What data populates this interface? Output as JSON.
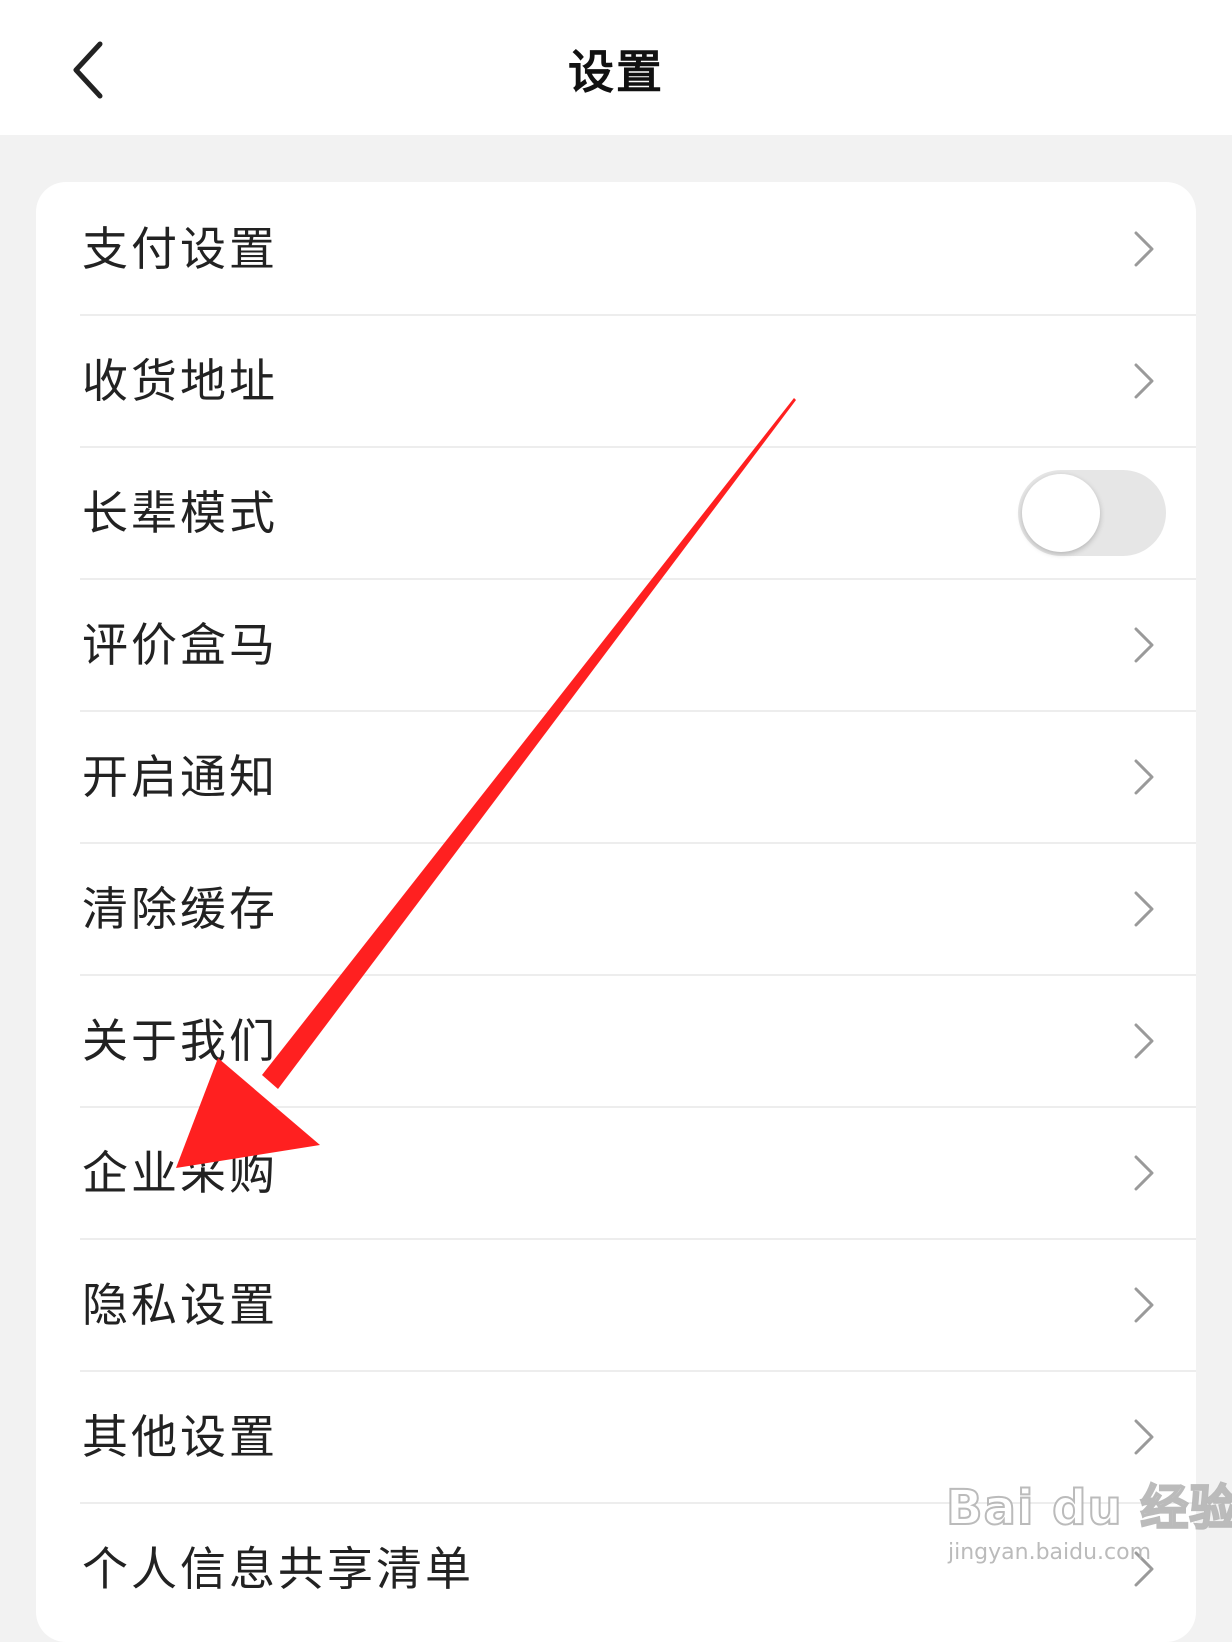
{
  "header": {
    "title": "设置",
    "back_icon": "chevron-left-icon"
  },
  "settings": {
    "items": [
      {
        "label": "支付设置",
        "control": "chevron"
      },
      {
        "label": "收货地址",
        "control": "chevron"
      },
      {
        "label": "长辈模式",
        "control": "toggle",
        "enabled": false
      },
      {
        "label": "评价盒马",
        "control": "chevron"
      },
      {
        "label": "开启通知",
        "control": "chevron"
      },
      {
        "label": "清除缓存",
        "control": "chevron"
      },
      {
        "label": "关于我们",
        "control": "chevron"
      },
      {
        "label": "企业采购",
        "control": "chevron"
      },
      {
        "label": "隐私设置",
        "control": "chevron"
      },
      {
        "label": "其他设置",
        "control": "chevron"
      },
      {
        "label": "个人信息共享清单",
        "control": "chevron"
      }
    ]
  },
  "annotation": {
    "type": "arrow",
    "color": "#ff2020",
    "points_to": "企业采购"
  },
  "watermark": {
    "logo": "Bai du 经验",
    "url": "jingyan.baidu.com"
  },
  "colors": {
    "page_background": "#f2f2f2",
    "card_background": "#ffffff",
    "toggle_off": "#e6e6e6",
    "arrow": "#ff2020"
  }
}
